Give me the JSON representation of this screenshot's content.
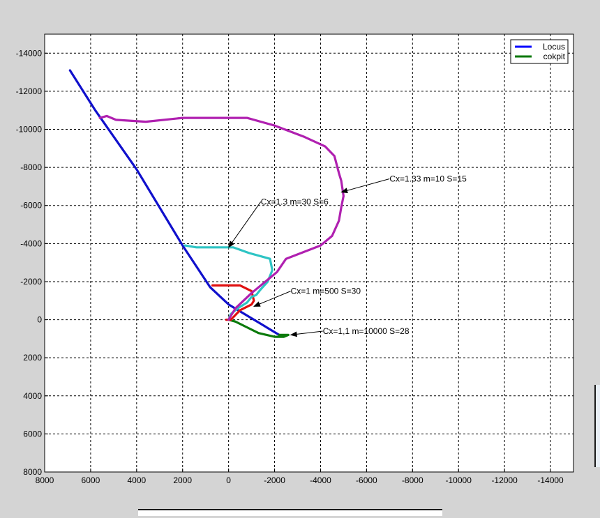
{
  "chart_data": {
    "type": "line",
    "xlim": [
      8000,
      -15000
    ],
    "ylim": [
      -15000,
      8000
    ],
    "x_reversed": true,
    "y_reversed": true,
    "grid": true,
    "grid_style": "dashed",
    "xticks": [
      8000,
      6000,
      4000,
      2000,
      0,
      -2000,
      -4000,
      -6000,
      -8000,
      -10000,
      -12000,
      -14000
    ],
    "yticks": [
      -14000,
      -12000,
      -10000,
      -8000,
      -6000,
      -4000,
      -2000,
      0,
      2000,
      4000,
      6000,
      8000
    ],
    "legend": {
      "placement": "top-right",
      "entries": [
        {
          "label": "Locus",
          "color": "#0000ff"
        },
        {
          "label": "cokpit",
          "color": "#007700"
        }
      ]
    },
    "series": [
      {
        "name": "Locus",
        "color": "#1010cc",
        "points": [
          [
            6900,
            -13100
          ],
          [
            5800,
            -11000
          ],
          [
            4000,
            -7900
          ],
          [
            2000,
            -3900
          ],
          [
            800,
            -1700
          ],
          [
            0,
            -800
          ],
          [
            -2200,
            800
          ]
        ]
      },
      {
        "color": "#0b7a0b",
        "points": [
          [
            0,
            0
          ],
          [
            -300,
            100
          ],
          [
            -800,
            400
          ],
          [
            -1300,
            700
          ],
          [
            -2000,
            900
          ],
          [
            -2400,
            900
          ],
          [
            -2600,
            800
          ],
          [
            -2200,
            800
          ]
        ]
      },
      {
        "color": "#e01010",
        "points": [
          [
            700,
            -1800
          ],
          [
            -500,
            -1800
          ],
          [
            -1000,
            -1500
          ],
          [
            -1100,
            -1000
          ],
          [
            -1000,
            -800
          ],
          [
            -500,
            -500
          ],
          [
            -100,
            0
          ],
          [
            100,
            0
          ]
        ]
      },
      {
        "color": "#2ec4c4",
        "points": [
          [
            1900,
            -3900
          ],
          [
            1400,
            -3800
          ],
          [
            500,
            -3800
          ],
          [
            -200,
            -3800
          ],
          [
            -900,
            -3500
          ],
          [
            -1800,
            -3200
          ],
          [
            -1900,
            -2600
          ],
          [
            -1700,
            -2000
          ],
          [
            -1400,
            -1600
          ],
          [
            -1200,
            -1300
          ],
          [
            -1000,
            -1200
          ],
          [
            -800,
            -900
          ],
          [
            -400,
            -600
          ],
          [
            -100,
            -300
          ],
          [
            0,
            0
          ]
        ]
      },
      {
        "color": "#b020b0",
        "points": [
          [
            5600,
            -10600
          ],
          [
            5300,
            -10700
          ],
          [
            4900,
            -10500
          ],
          [
            3600,
            -10400
          ],
          [
            2000,
            -10600
          ],
          [
            1000,
            -10600
          ],
          [
            -800,
            -10600
          ],
          [
            -2000,
            -10200
          ],
          [
            -3300,
            -9600
          ],
          [
            -4200,
            -9100
          ],
          [
            -4600,
            -8600
          ],
          [
            -4800,
            -7700
          ],
          [
            -4900,
            -7300
          ],
          [
            -5000,
            -6500
          ],
          [
            -4900,
            -5900
          ],
          [
            -4800,
            -5200
          ],
          [
            -4500,
            -4400
          ],
          [
            -4000,
            -3900
          ],
          [
            -2500,
            -3200
          ],
          [
            -2100,
            -2500
          ],
          [
            -1600,
            -2000
          ],
          [
            -1000,
            -1400
          ],
          [
            -300,
            -600
          ],
          [
            -100,
            -200
          ],
          [
            0,
            0
          ]
        ]
      }
    ],
    "annotations": [
      {
        "text": "Cx=1.33 m=10 S=15",
        "arrow_tip": [
          -4900,
          -6700
        ],
        "text_at": [
          -7000,
          -7400
        ]
      },
      {
        "text": "Cx=1.3 m=30 S=6",
        "arrow_tip": [
          0,
          -3800
        ],
        "text_at": [
          -1400,
          -6200
        ]
      },
      {
        "text": "Cx=1 m=500 S=30",
        "arrow_tip": [
          -1100,
          -700
        ],
        "text_at": [
          -2700,
          -1500
        ]
      },
      {
        "text": "Cx=1,1 m=10000 S=28",
        "arrow_tip": [
          -2700,
          800
        ],
        "text_at": [
          -4100,
          600
        ]
      }
    ]
  }
}
